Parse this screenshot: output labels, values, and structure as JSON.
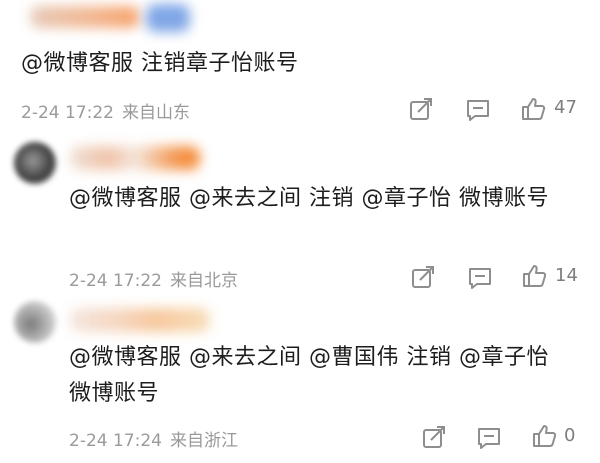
{
  "comments": [
    {
      "text": "@微博客服 注销章子怡账号",
      "date": "2-24 17:22",
      "location": "来自山东",
      "likes": "47"
    },
    {
      "text": "@微博客服 @来去之间 注销 @章子怡 微博账号",
      "date": "2-24 17:22",
      "location": "来自北京",
      "likes": "14"
    },
    {
      "text": "@微博客服 @来去之间 @曹国伟 注销 @章子怡 微博账号",
      "date": "2-24 17:24",
      "location": "来自浙江",
      "likes": "0"
    }
  ],
  "icons": {
    "share": "share-icon",
    "comment": "comment-icon",
    "like": "thumbs-up-icon"
  }
}
